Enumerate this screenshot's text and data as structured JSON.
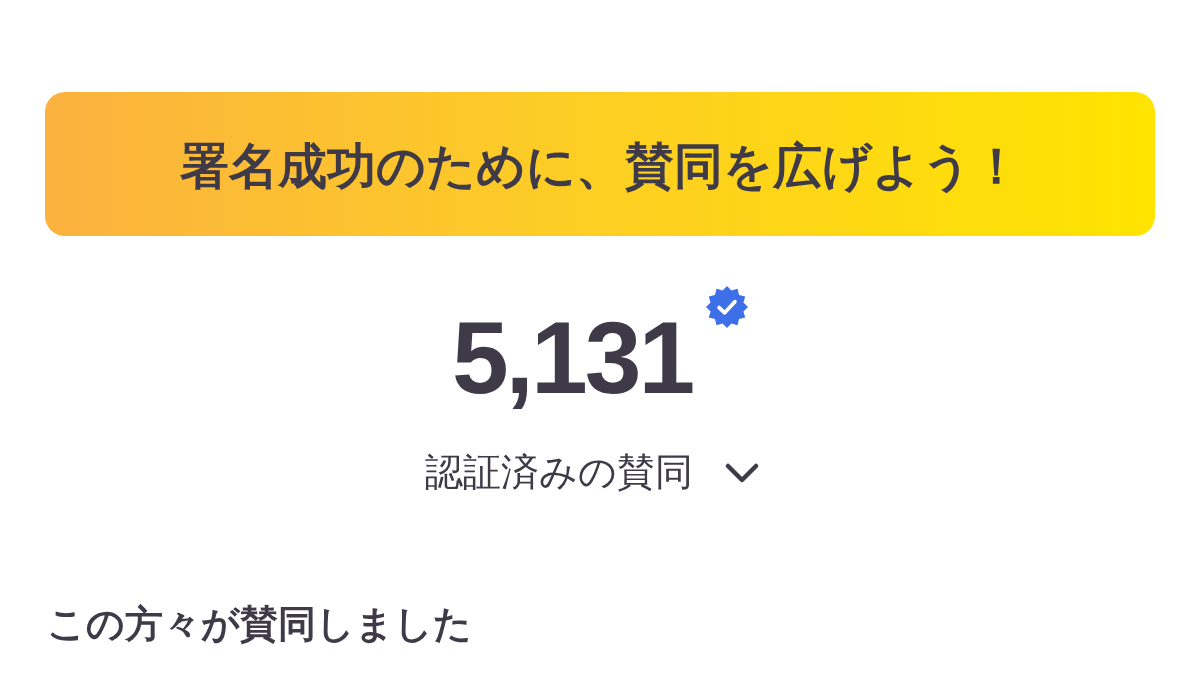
{
  "banner": {
    "text": "署名成功のために、賛同を広げよう！"
  },
  "counter": {
    "value": "5,131",
    "verified": true
  },
  "filter": {
    "label": "認証済みの賛同",
    "expanded": false
  },
  "section": {
    "title": "この方々が賛同しました"
  }
}
